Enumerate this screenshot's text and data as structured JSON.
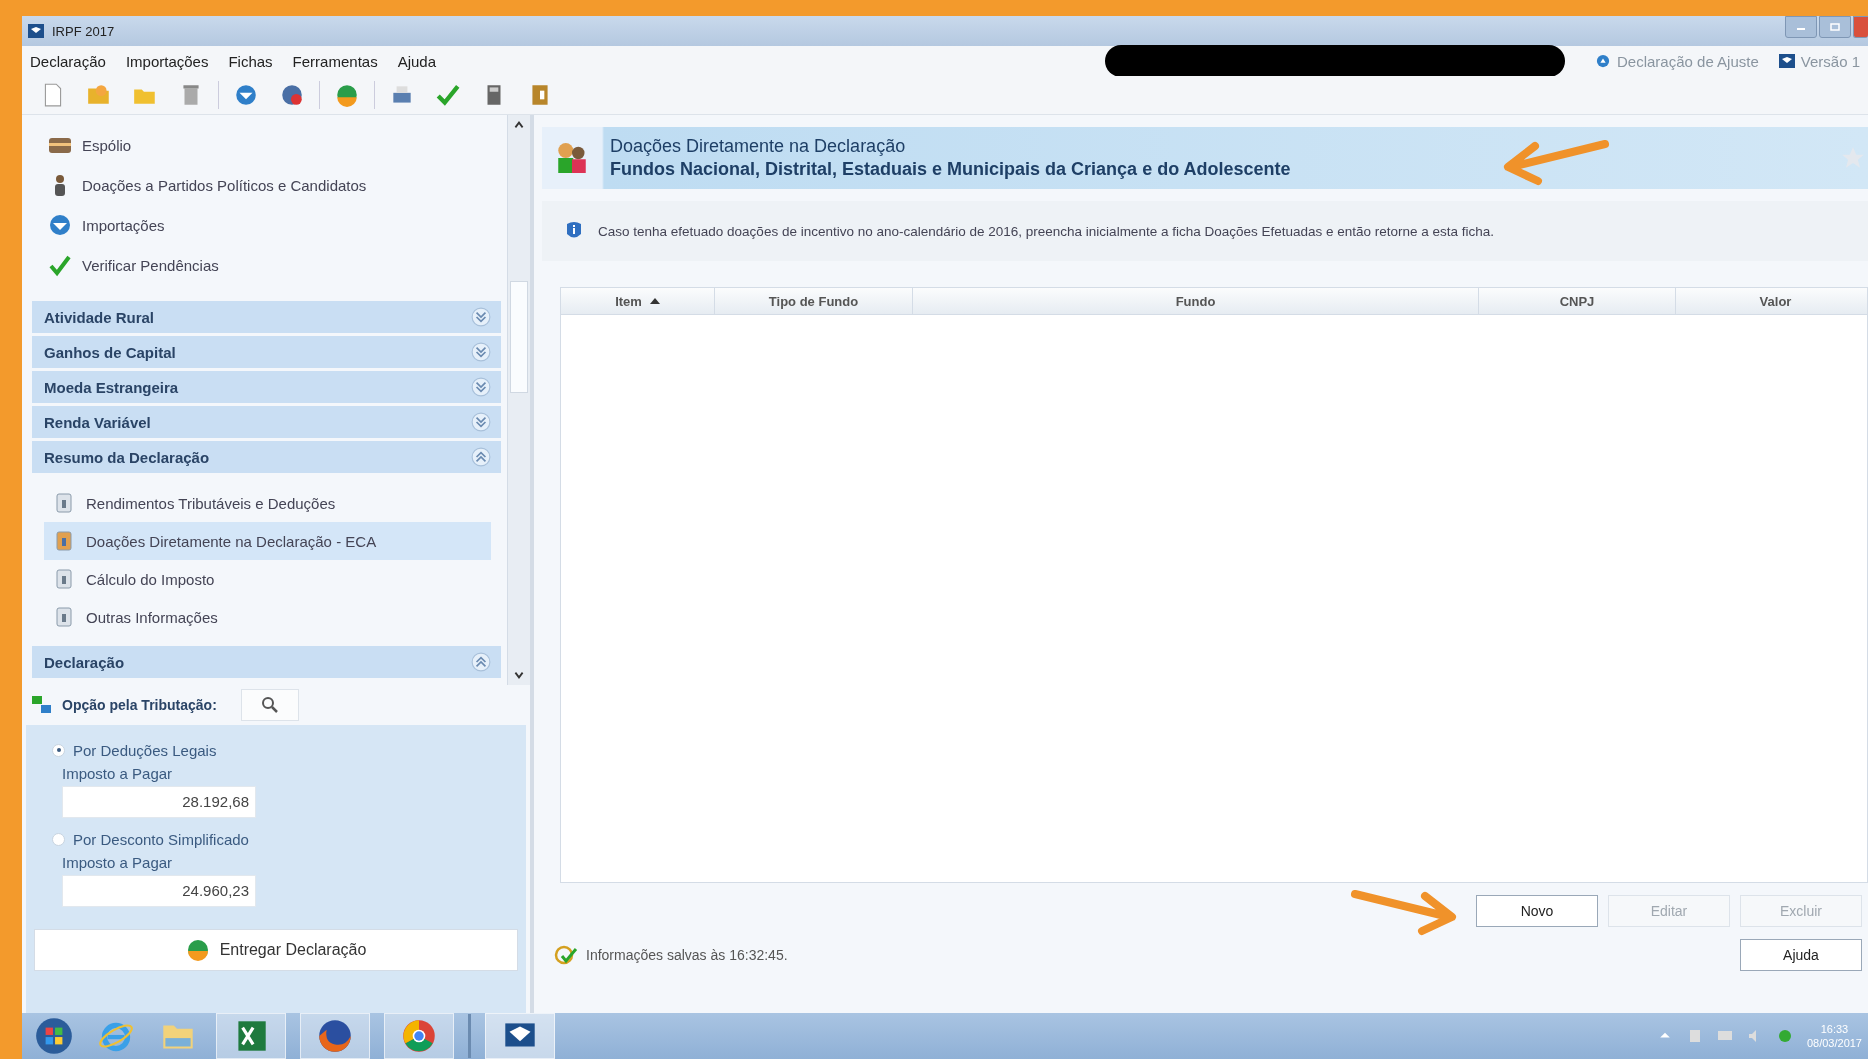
{
  "window": {
    "title": "IRPF 2017"
  },
  "menu": [
    "Declaração",
    "Importações",
    "Fichas",
    "Ferramentas",
    "Ajuda"
  ],
  "header_links": [
    "Declaração de Ajuste",
    "Versão 1"
  ],
  "sidebar": {
    "top_items": [
      "Espólio",
      "Doações a Partidos Políticos e Candidatos",
      "Importações",
      "Verificar Pendências"
    ],
    "sections": [
      {
        "label": "Atividade Rural",
        "expanded": false
      },
      {
        "label": "Ganhos de Capital",
        "expanded": false
      },
      {
        "label": "Moeda Estrangeira",
        "expanded": false
      },
      {
        "label": "Renda Variável",
        "expanded": false
      },
      {
        "label": "Resumo da Declaração",
        "expanded": true,
        "children": [
          {
            "label": "Rendimentos Tributáveis e Deduções",
            "selected": false
          },
          {
            "label": "Doações Diretamente na Declaração - ECA",
            "selected": true
          },
          {
            "label": "Cálculo do Imposto",
            "selected": false
          },
          {
            "label": "Outras Informações",
            "selected": false
          }
        ]
      },
      {
        "label": "Declaração",
        "expanded": true
      }
    ]
  },
  "tax_option": {
    "title": "Opção pela Tributação:",
    "options": [
      {
        "label": "Por Deduções Legais",
        "selected": true,
        "amount_label": "Imposto a Pagar",
        "amount": "28.192,68"
      },
      {
        "label": "Por Desconto Simplificado",
        "selected": false,
        "amount_label": "Imposto a Pagar",
        "amount": "24.960,23"
      }
    ]
  },
  "deliver_button": "Entregar Declaração",
  "page": {
    "title": "Doações Diretamente na Declaração",
    "subtitle": "Fundos Nacional, Distrital, Estaduais e Municipais da Criança e do Adolescente",
    "info": "Caso tenha efetuado doações de incentivo no ano-calendário de 2016, preencha inicialmente a ficha Doações Efetuadas e então retorne a esta ficha.",
    "table": {
      "columns": [
        {
          "label": "Item",
          "sorted": true
        },
        {
          "label": "Tipo de Fundo",
          "sorted": false
        },
        {
          "label": "Fundo",
          "sorted": false
        },
        {
          "label": "CNPJ",
          "sorted": false
        },
        {
          "label": "Valor",
          "sorted": false
        }
      ]
    },
    "buttons": [
      {
        "label": "Novo",
        "disabled": false
      },
      {
        "label": "Editar",
        "disabled": true
      },
      {
        "label": "Excluir",
        "disabled": true
      }
    ],
    "status": "Informações salvas às 16:32:45.",
    "help_button": "Ajuda"
  },
  "taskbar": {
    "clock": "16:33",
    "date": "08/03/2017"
  }
}
